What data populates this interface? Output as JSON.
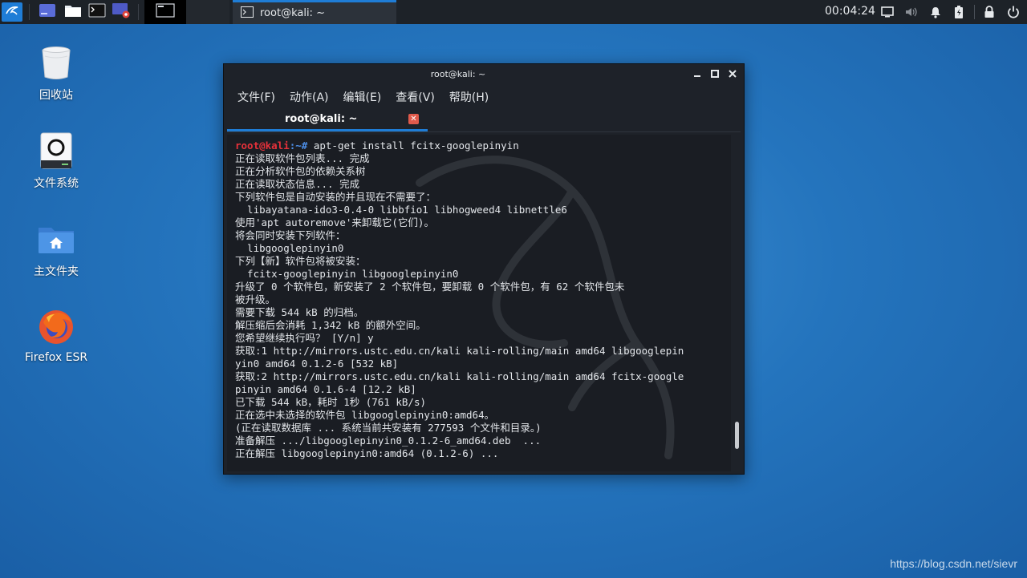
{
  "panel": {
    "clock": "00:04:24",
    "task": {
      "label": "root@kali: ~"
    }
  },
  "desktop": {
    "icons": [
      {
        "label": "回收站",
        "icon": "trash-icon"
      },
      {
        "label": "文件系统",
        "icon": "drive-icon"
      },
      {
        "label": "主文件夹",
        "icon": "home-folder-icon"
      },
      {
        "label": "Firefox ESR",
        "icon": "firefox-icon"
      }
    ]
  },
  "terminal": {
    "title": "root@kali: ~",
    "menu": [
      "文件(F)",
      "动作(A)",
      "编辑(E)",
      "查看(V)",
      "帮助(H)"
    ],
    "tab_label": "root@kali: ~",
    "prompt_user": "root@kali",
    "prompt_path": ":~# ",
    "command": "apt-get install fcitx-googlepinyin",
    "output": [
      "正在读取软件包列表... 完成",
      "正在分析软件包的依赖关系树",
      "正在读取状态信息... 完成",
      "下列软件包是自动安装的并且现在不需要了：",
      "  libayatana-ido3-0.4-0 libbfio1 libhogweed4 libnettle6",
      "使用'apt autoremove'来卸载它(它们)。",
      "将会同时安装下列软件：",
      "  libgooglepinyin0",
      "下列【新】软件包将被安装：",
      "  fcitx-googlepinyin libgooglepinyin0",
      "升级了 0 个软件包，新安装了 2 个软件包，要卸载 0 个软件包，有 62 个软件包未",
      "被升级。",
      "需要下载 544 kB 的归档。",
      "解压缩后会消耗 1,342 kB 的额外空间。",
      "您希望继续执行吗？ [Y/n] y",
      "获取:1 http://mirrors.ustc.edu.cn/kali kali-rolling/main amd64 libgooglepin",
      "yin0 amd64 0.1.2-6 [532 kB]",
      "获取:2 http://mirrors.ustc.edu.cn/kali kali-rolling/main amd64 fcitx-google",
      "pinyin amd64 0.1.6-4 [12.2 kB]",
      "已下载 544 kB，耗时 1秒 (761 kB/s)",
      "正在选中未选择的软件包 libgooglepinyin0:amd64。",
      "(正在读取数据库 ... 系统当前共安装有 277593 个文件和目录。)",
      "准备解压 .../libgooglepinyin0_0.1.2-6_amd64.deb  ...",
      "正在解压 libgooglepinyin0:amd64 (0.1.2-6) ..."
    ]
  },
  "watermark": "https://blog.csdn.net/sievr",
  "colors": {
    "accent": "#1f7dd6",
    "prompt_user": "#e6313a",
    "prompt_path": "#4d8fe8",
    "terminal_bg": "#1a1d23"
  }
}
